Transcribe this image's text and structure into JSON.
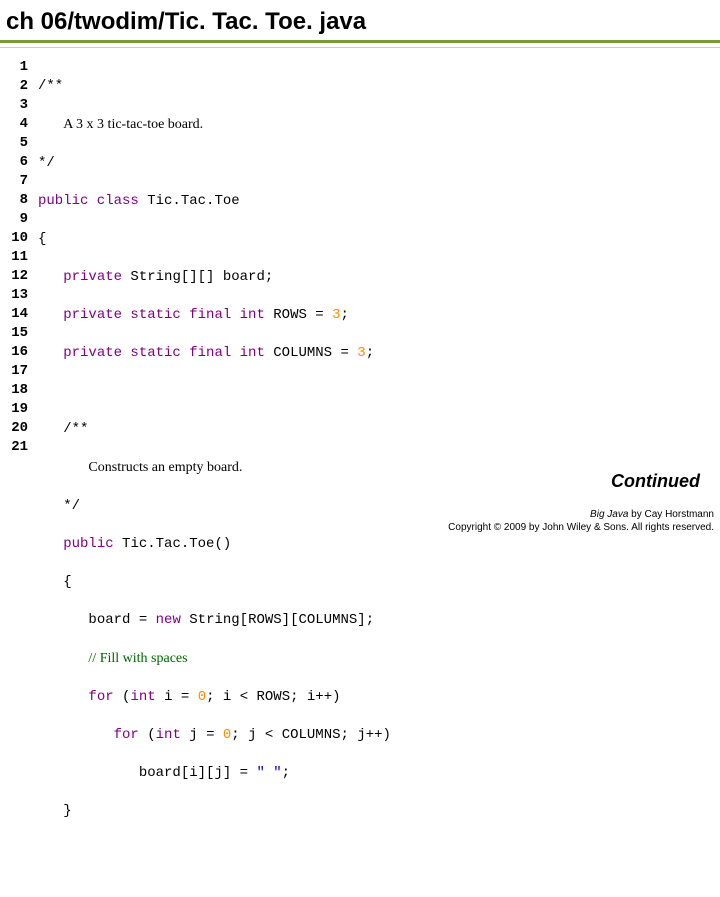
{
  "title": "ch 06/twodim/Tic. Tac. Toe. java",
  "lineNumbers": [
    "1",
    "2",
    "3",
    "4",
    "5",
    "6",
    "7",
    "8",
    "9",
    "10",
    "11",
    "12",
    "13",
    "14",
    "15",
    "16",
    "17",
    "18",
    "19",
    "20",
    "21"
  ],
  "code": {
    "l1": "/**",
    "l2_indent": "   ",
    "l2_doc": "A 3 x 3 tic-tac-toe board.",
    "l3": "*/",
    "l4_kw": "public class",
    "l4_rest": " Tic.Tac.Toe",
    "l5": "{",
    "l6_pre": "   ",
    "l6_kw": "private",
    "l6_rest": " String[][] board;",
    "l7_pre": "   ",
    "l7_kw": "private static final int",
    "l7_mid": " ROWS = ",
    "l7_num": "3",
    "l7_end": ";",
    "l8_pre": "   ",
    "l8_kw": "private static final int",
    "l8_mid": " COLUMNS = ",
    "l8_num": "3",
    "l8_end": ";",
    "l10_pre": "   ",
    "l10": "/**",
    "l11_pre": "      ",
    "l11_doc": "Constructs an empty board.",
    "l12_pre": "   ",
    "l12": "*/",
    "l13_pre": "   ",
    "l13_kw": "public",
    "l13_rest": " Tic.Tac.Toe()",
    "l14_pre": "   ",
    "l14": "{",
    "l15_pre": "      ",
    "l15_a": "board = ",
    "l15_kw": "new",
    "l15_b": " String[ROWS][COLUMNS];",
    "l16_pre": "      ",
    "l16_cm": "// Fill with spaces",
    "l17_pre": "      ",
    "l17_kw1": "for",
    "l17_a": " (",
    "l17_kw2": "int",
    "l17_b": " i = ",
    "l17_n": "0",
    "l17_c": "; i < ROWS; i++)",
    "l18_pre": "         ",
    "l18_kw1": "for",
    "l18_a": " (",
    "l18_kw2": "int",
    "l18_b": " j = ",
    "l18_n": "0",
    "l18_c": "; j < COLUMNS; j++)",
    "l19_pre": "            ",
    "l19_a": "board[i][j] = ",
    "l19_str": "\" \"",
    "l19_b": ";",
    "l20_pre": "   ",
    "l20": "}"
  },
  "continued": "Continued",
  "footer": {
    "book": "Big Java",
    "by": " by Cay Horstmann",
    "copyright": "Copyright © 2009 by John Wiley & Sons.  All rights reserved."
  }
}
